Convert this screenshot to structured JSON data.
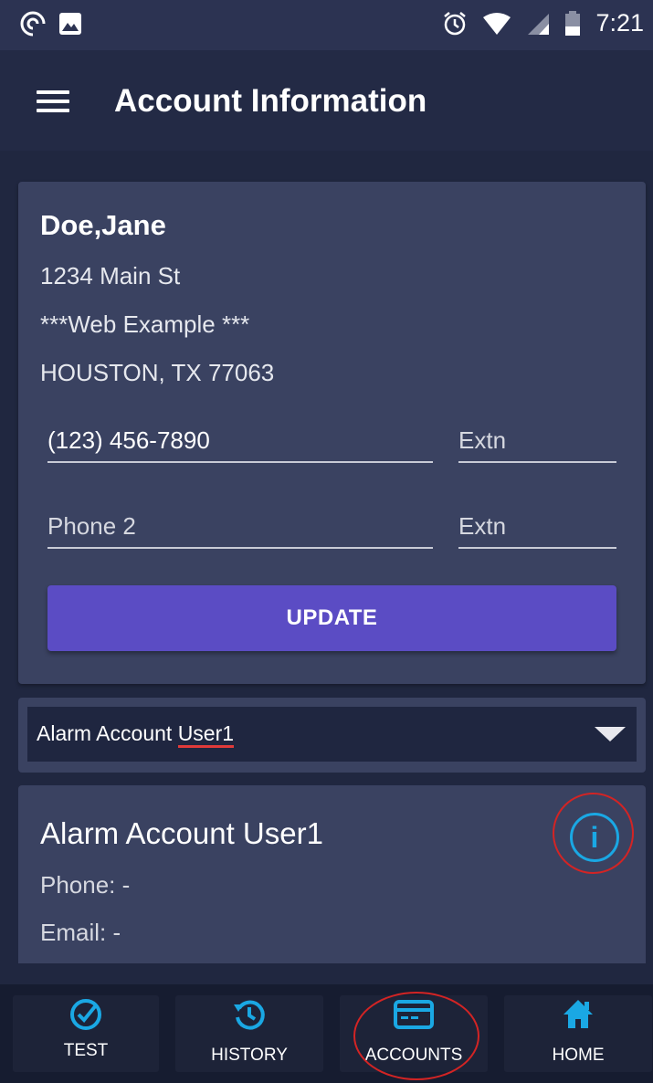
{
  "status_bar": {
    "time": "7:21"
  },
  "app_bar": {
    "title": "Account Information"
  },
  "account": {
    "name": "Doe,Jane",
    "address_line1": "1234 Main St",
    "address_line2": "***Web Example ***",
    "address_line3": "HOUSTON, TX 77063",
    "phone1_value": "(123) 456-7890",
    "phone1_ext_placeholder": "Extn",
    "phone2_placeholder": "Phone 2",
    "phone2_ext_placeholder": "Extn",
    "update_label": "UPDATE"
  },
  "user_select": {
    "selected_prefix": "Alarm Account ",
    "selected_suffix": "User1"
  },
  "user_card": {
    "name": "Alarm Account User1",
    "phone": "Phone: -",
    "email": "Email: -",
    "info_icon": "info-icon"
  },
  "bottom_nav": {
    "items": [
      {
        "label": "TEST",
        "icon": "check-circle-icon"
      },
      {
        "label": "HISTORY",
        "icon": "history-icon"
      },
      {
        "label": "ACCOUNTS",
        "icon": "card-icon"
      },
      {
        "label": "HOME",
        "icon": "home-icon"
      }
    ]
  },
  "colors": {
    "accent": "#5b4cc4",
    "info_blue": "#1aa8e4",
    "annotation_red": "#d32424"
  }
}
